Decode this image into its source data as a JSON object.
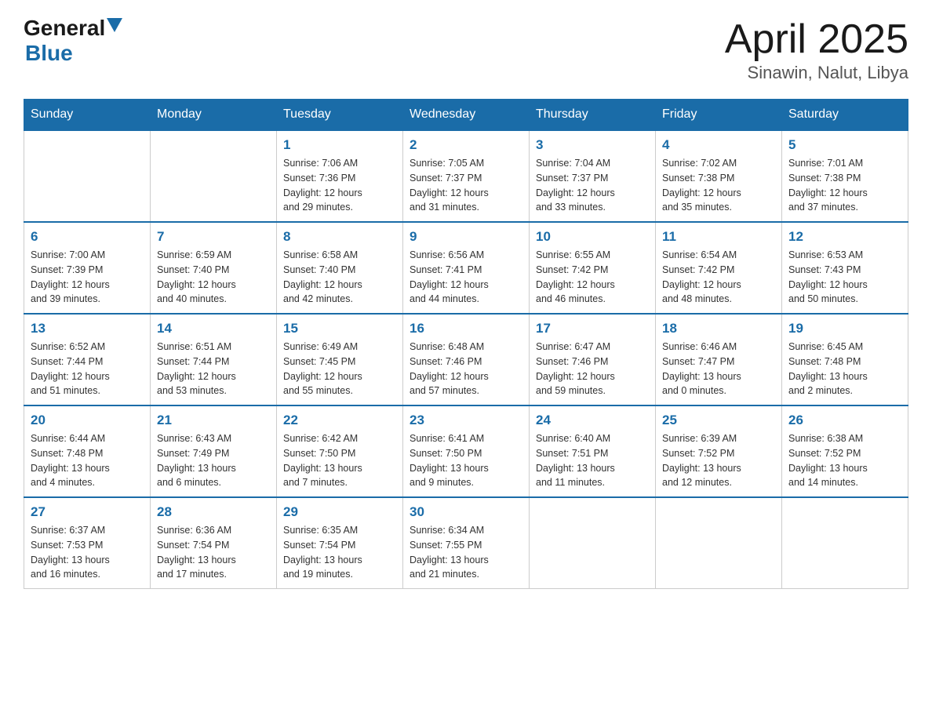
{
  "header": {
    "logo_general": "General",
    "logo_blue": "Blue",
    "title": "April 2025",
    "location": "Sinawin, Nalut, Libya"
  },
  "days_of_week": [
    "Sunday",
    "Monday",
    "Tuesday",
    "Wednesday",
    "Thursday",
    "Friday",
    "Saturday"
  ],
  "weeks": [
    [
      {
        "day": "",
        "info": ""
      },
      {
        "day": "",
        "info": ""
      },
      {
        "day": "1",
        "info": "Sunrise: 7:06 AM\nSunset: 7:36 PM\nDaylight: 12 hours\nand 29 minutes."
      },
      {
        "day": "2",
        "info": "Sunrise: 7:05 AM\nSunset: 7:37 PM\nDaylight: 12 hours\nand 31 minutes."
      },
      {
        "day": "3",
        "info": "Sunrise: 7:04 AM\nSunset: 7:37 PM\nDaylight: 12 hours\nand 33 minutes."
      },
      {
        "day": "4",
        "info": "Sunrise: 7:02 AM\nSunset: 7:38 PM\nDaylight: 12 hours\nand 35 minutes."
      },
      {
        "day": "5",
        "info": "Sunrise: 7:01 AM\nSunset: 7:38 PM\nDaylight: 12 hours\nand 37 minutes."
      }
    ],
    [
      {
        "day": "6",
        "info": "Sunrise: 7:00 AM\nSunset: 7:39 PM\nDaylight: 12 hours\nand 39 minutes."
      },
      {
        "day": "7",
        "info": "Sunrise: 6:59 AM\nSunset: 7:40 PM\nDaylight: 12 hours\nand 40 minutes."
      },
      {
        "day": "8",
        "info": "Sunrise: 6:58 AM\nSunset: 7:40 PM\nDaylight: 12 hours\nand 42 minutes."
      },
      {
        "day": "9",
        "info": "Sunrise: 6:56 AM\nSunset: 7:41 PM\nDaylight: 12 hours\nand 44 minutes."
      },
      {
        "day": "10",
        "info": "Sunrise: 6:55 AM\nSunset: 7:42 PM\nDaylight: 12 hours\nand 46 minutes."
      },
      {
        "day": "11",
        "info": "Sunrise: 6:54 AM\nSunset: 7:42 PM\nDaylight: 12 hours\nand 48 minutes."
      },
      {
        "day": "12",
        "info": "Sunrise: 6:53 AM\nSunset: 7:43 PM\nDaylight: 12 hours\nand 50 minutes."
      }
    ],
    [
      {
        "day": "13",
        "info": "Sunrise: 6:52 AM\nSunset: 7:44 PM\nDaylight: 12 hours\nand 51 minutes."
      },
      {
        "day": "14",
        "info": "Sunrise: 6:51 AM\nSunset: 7:44 PM\nDaylight: 12 hours\nand 53 minutes."
      },
      {
        "day": "15",
        "info": "Sunrise: 6:49 AM\nSunset: 7:45 PM\nDaylight: 12 hours\nand 55 minutes."
      },
      {
        "day": "16",
        "info": "Sunrise: 6:48 AM\nSunset: 7:46 PM\nDaylight: 12 hours\nand 57 minutes."
      },
      {
        "day": "17",
        "info": "Sunrise: 6:47 AM\nSunset: 7:46 PM\nDaylight: 12 hours\nand 59 minutes."
      },
      {
        "day": "18",
        "info": "Sunrise: 6:46 AM\nSunset: 7:47 PM\nDaylight: 13 hours\nand 0 minutes."
      },
      {
        "day": "19",
        "info": "Sunrise: 6:45 AM\nSunset: 7:48 PM\nDaylight: 13 hours\nand 2 minutes."
      }
    ],
    [
      {
        "day": "20",
        "info": "Sunrise: 6:44 AM\nSunset: 7:48 PM\nDaylight: 13 hours\nand 4 minutes."
      },
      {
        "day": "21",
        "info": "Sunrise: 6:43 AM\nSunset: 7:49 PM\nDaylight: 13 hours\nand 6 minutes."
      },
      {
        "day": "22",
        "info": "Sunrise: 6:42 AM\nSunset: 7:50 PM\nDaylight: 13 hours\nand 7 minutes."
      },
      {
        "day": "23",
        "info": "Sunrise: 6:41 AM\nSunset: 7:50 PM\nDaylight: 13 hours\nand 9 minutes."
      },
      {
        "day": "24",
        "info": "Sunrise: 6:40 AM\nSunset: 7:51 PM\nDaylight: 13 hours\nand 11 minutes."
      },
      {
        "day": "25",
        "info": "Sunrise: 6:39 AM\nSunset: 7:52 PM\nDaylight: 13 hours\nand 12 minutes."
      },
      {
        "day": "26",
        "info": "Sunrise: 6:38 AM\nSunset: 7:52 PM\nDaylight: 13 hours\nand 14 minutes."
      }
    ],
    [
      {
        "day": "27",
        "info": "Sunrise: 6:37 AM\nSunset: 7:53 PM\nDaylight: 13 hours\nand 16 minutes."
      },
      {
        "day": "28",
        "info": "Sunrise: 6:36 AM\nSunset: 7:54 PM\nDaylight: 13 hours\nand 17 minutes."
      },
      {
        "day": "29",
        "info": "Sunrise: 6:35 AM\nSunset: 7:54 PM\nDaylight: 13 hours\nand 19 minutes."
      },
      {
        "day": "30",
        "info": "Sunrise: 6:34 AM\nSunset: 7:55 PM\nDaylight: 13 hours\nand 21 minutes."
      },
      {
        "day": "",
        "info": ""
      },
      {
        "day": "",
        "info": ""
      },
      {
        "day": "",
        "info": ""
      }
    ]
  ]
}
